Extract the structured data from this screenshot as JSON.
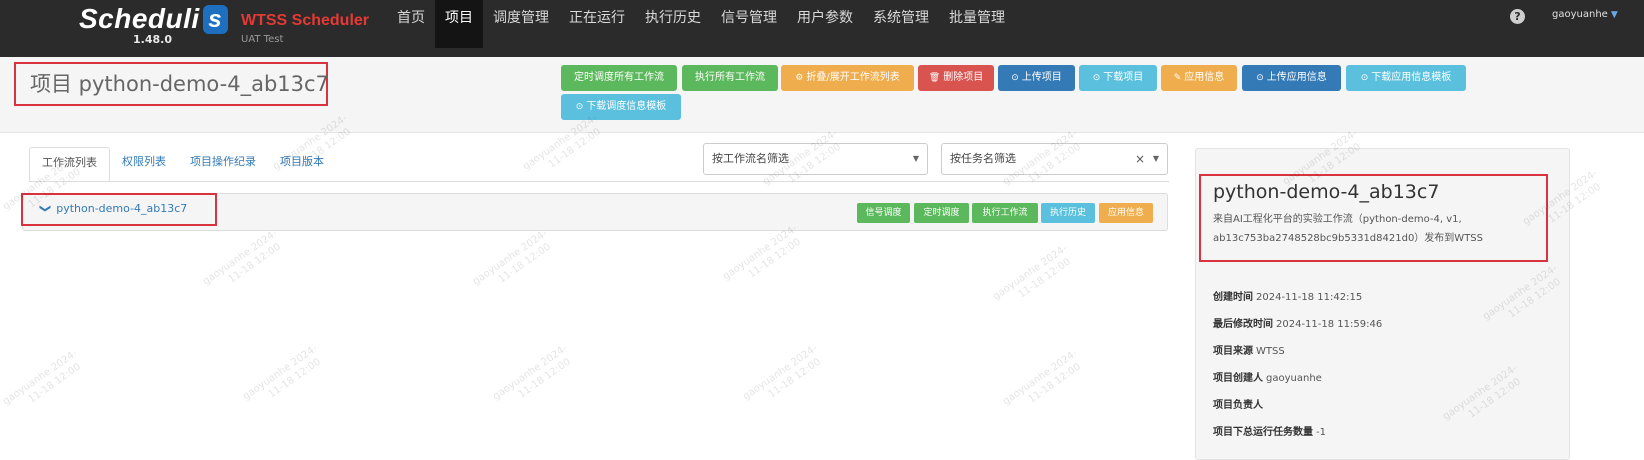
{
  "brand": {
    "name": "Scheduli",
    "s_letter": "s",
    "version": "1.48.0",
    "product": "WTSS Scheduler",
    "env": "UAT Test"
  },
  "nav": {
    "items": [
      "首页",
      "项目",
      "调度管理",
      "正在运行",
      "执行历史",
      "信号管理",
      "用户参数",
      "系统管理",
      "批量管理"
    ],
    "active_index": 1
  },
  "user": {
    "icon": "question-circle-icon",
    "icon_glyph": "?",
    "name": "gaoyuanhe",
    "caret": "▼"
  },
  "page": {
    "title": "项目 python-demo-4_ab13c7"
  },
  "actions": [
    {
      "label": "定时调度所有工作流",
      "icon": "",
      "color": "#5cb85c"
    },
    {
      "label": "执行所有工作流",
      "icon": "",
      "color": "#5cb85c"
    },
    {
      "label": "折叠/展开工作流列表",
      "icon": "⚙",
      "color": "#f0ad4e"
    },
    {
      "label": "删除项目",
      "icon": "🗑",
      "color": "#d9534f"
    },
    {
      "label": "上传项目",
      "icon": "⊙",
      "color": "#337ab7"
    },
    {
      "label": "下载项目",
      "icon": "⊙",
      "color": "#5bc0de"
    },
    {
      "label": "应用信息",
      "icon": "✎",
      "color": "#f0ad4e"
    },
    {
      "label": "上传应用信息",
      "icon": "⊙",
      "color": "#337ab7"
    },
    {
      "label": "下载应用信息模板",
      "icon": "⊙",
      "color": "#5bc0de"
    },
    {
      "label": "下载调度信息模板",
      "icon": "⊙",
      "color": "#5bc0de"
    }
  ],
  "tabs": [
    "工作流列表",
    "权限列表",
    "项目操作纪录",
    "项目版本"
  ],
  "filters": {
    "flow": {
      "placeholder": "按工作流名筛选",
      "caret": "▼"
    },
    "job": {
      "placeholder": "按任务名筛选",
      "clear": "×",
      "caret": "▼"
    }
  },
  "flow": {
    "chevron": "❯",
    "name": "python-demo-4_ab13c7",
    "buttons": [
      {
        "label": "信号调度",
        "color": "#5cb85c"
      },
      {
        "label": "定时调度",
        "color": "#5cb85c"
      },
      {
        "label": "执行工作流",
        "color": "#5cb85c"
      },
      {
        "label": "执行历史",
        "color": "#5bc0de"
      },
      {
        "label": "应用信息",
        "color": "#f0ad4e"
      }
    ]
  },
  "info": {
    "title": "python-demo-4_ab13c7",
    "description": "来自AI工程化平台的实验工作流（python-demo-4, v1, ab13c753ba2748528bc9b5331d8421d0）发布到WTSS",
    "fields": [
      {
        "label": "创建时间",
        "value": "2024-11-18 11:42:15"
      },
      {
        "label": "最后修改时间",
        "value": "2024-11-18 11:59:46"
      },
      {
        "label": "项目来源",
        "value": "WTSS"
      },
      {
        "label": "项目创建人",
        "value": "gaoyuanhe"
      },
      {
        "label": "项目负责人",
        "value": ""
      },
      {
        "label": "项目下总运行任务数量",
        "value": "-1"
      }
    ]
  },
  "watermark": {
    "line1": "gaoyuanhe 2024-",
    "line2": "11-18 12:00"
  }
}
